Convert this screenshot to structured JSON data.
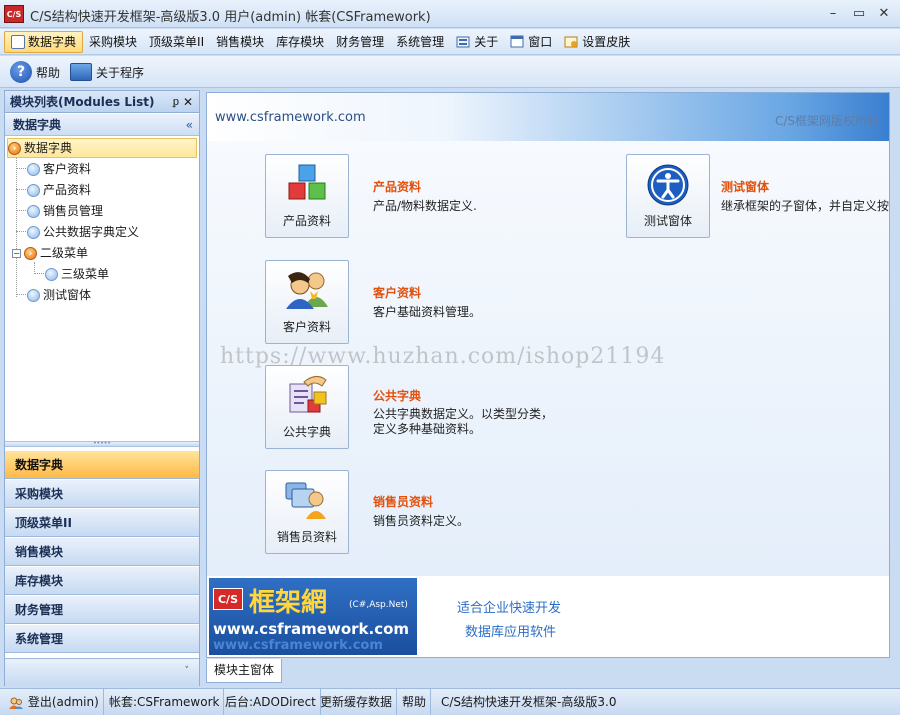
{
  "window": {
    "logo": "C/S",
    "title": "C/S结构快速开发框架-高级版3.0 用户(admin) 帐套(CSFramework)",
    "min": "–",
    "max": "▭",
    "close": "✕"
  },
  "menu": [
    {
      "label": "数据字典",
      "icon": "data-dict-icon"
    },
    {
      "label": "采购模块"
    },
    {
      "label": "顶级菜单II"
    },
    {
      "label": "销售模块"
    },
    {
      "label": "库存模块"
    },
    {
      "label": "财务管理"
    },
    {
      "label": "系统管理"
    },
    {
      "label": "关于",
      "icon": "about-icon"
    },
    {
      "label": "窗口",
      "icon": "window-icon"
    },
    {
      "label": "设置皮肤",
      "icon": "skin-icon"
    }
  ],
  "toolbar": {
    "help": "帮助",
    "about": "关于程序"
  },
  "left_panel": {
    "title": "模块列表(Modules List)",
    "pin": "ᵱ",
    "close": "✕",
    "group": "数据字典",
    "collapse": "«",
    "tree": {
      "root": "数据字典",
      "n1": "客户资料",
      "n2": "产品资料",
      "n3": "销售员管理",
      "n4": "公共数据字典定义",
      "n5": "二级菜单",
      "n6": "三级菜单",
      "n7": "测试窗体"
    },
    "nav": [
      "数据字典",
      "采购模块",
      "顶级菜单II",
      "销售模块",
      "库存模块",
      "财务管理",
      "系统管理"
    ],
    "more": "˅"
  },
  "main": {
    "banner_left": "www.csframework.com",
    "banner_right": "C/S框架网版权所有",
    "modules": {
      "product": {
        "button": "产品资料",
        "title": "产品资料",
        "desc": "产品/物料数据定义."
      },
      "customer": {
        "button": "客户资料",
        "title": "客户资料",
        "desc": "客户基础资料管理。"
      },
      "common": {
        "button": "公共字典",
        "title": "公共字典",
        "desc1": "公共字典数据定义。以类型分类，",
        "desc2": "定义多种基础资料。"
      },
      "sales": {
        "button": "销售员资料",
        "title": "销售员资料",
        "desc": "销售员资料定义。"
      },
      "test": {
        "button": "测试窗体",
        "title": "测试窗体",
        "desc": "继承框架的子窗体，并自定义按"
      }
    },
    "ad": {
      "cs": "C/S",
      "name": "框架網",
      "tag": "(C#,Asp.Net)",
      "url": "www.csframework.com",
      "url2": "www.csframework.com",
      "line1": "适合企业快速开发",
      "line2": "数据库应用软件"
    },
    "watermark": "https://www.huzhan.com/ishop21194",
    "doc_tab": "模块主窗体"
  },
  "status": {
    "logout": "登出(admin)",
    "account": "帐套:CSFramework",
    "backend": "后台:ADODirect",
    "refresh": "更新缓存数据",
    "help": "帮助",
    "product": "C/S结构快速开发框架-高级版3.0"
  }
}
